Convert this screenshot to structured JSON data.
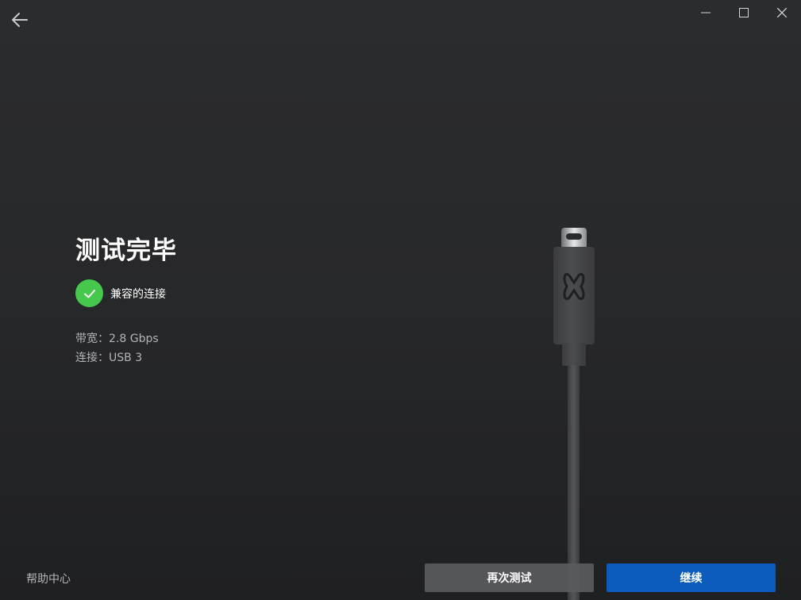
{
  "window": {
    "icons": {
      "back": "arrow-left-icon",
      "minimize": "minimize-icon",
      "maximize": "maximize-icon",
      "close": "close-icon"
    }
  },
  "main": {
    "title": "测试完毕",
    "status_icon": "check-circle-icon",
    "status_text": "兼容的连接",
    "bandwidth": "带宽：2.8 Gbps",
    "connection": "连接：USB 3"
  },
  "illustration": {
    "type": "usb-c-cable",
    "logo": "meta-logo"
  },
  "footer": {
    "help_label": "帮助中心",
    "retest_label": "再次测试",
    "continue_label": "继续"
  },
  "colors": {
    "background": "#27282a",
    "success": "#46c84d",
    "primary_button": "#0b5cbd",
    "secondary_button": "#5a5b5e",
    "muted_text": "#b3b4b6"
  }
}
